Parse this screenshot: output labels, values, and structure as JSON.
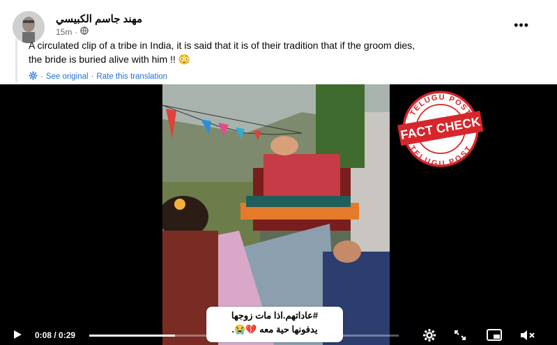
{
  "post": {
    "author": "مهند جاسم الكبيسي",
    "time": "15m",
    "privacy_icon": "globe-icon",
    "more_label": "•••",
    "text_line1": "A circulated clip of a tribe in India, it is said that it is of their tradition that if the groom dies,",
    "text_line2": "the bride is buried alive with him !! 😳",
    "see_original": "See original",
    "rate_translation": "Rate this translation",
    "separator": "·"
  },
  "video": {
    "caption_line1": "#عاداتهم.اذا مات زوجها",
    "caption_line2": "يدفونها حية معه 💔😭.",
    "stamp_top": "TELUGU POST",
    "stamp_main": "FACT CHECK",
    "stamp_bottom": "TELUGU POST",
    "stamp_color": "#d6262b",
    "time_display": "0:08 / 0:29",
    "progress": 0.276
  }
}
